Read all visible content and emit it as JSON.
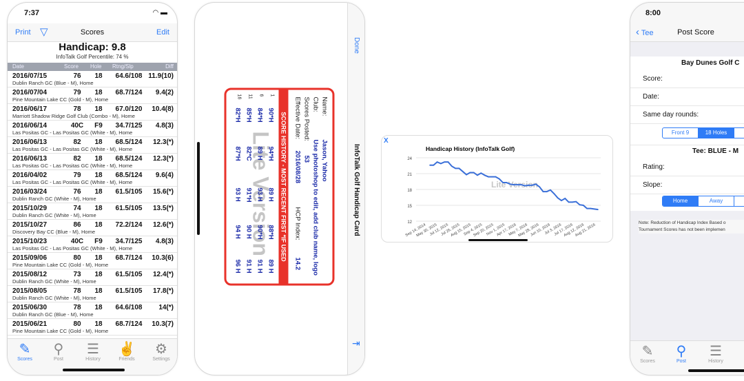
{
  "scores_screen": {
    "time": "7:37",
    "nav": {
      "print": "Print",
      "title": "Scores",
      "edit": "Edit"
    },
    "handicap": "Handicap: 9.8",
    "percentile": "InfoTalk Golf Percentile: 74 %",
    "columns": [
      "Date",
      "Score",
      "Hole",
      "Rtng/Slp",
      "Diff"
    ],
    "rows": [
      {
        "date": "2016/07/15",
        "score": "76",
        "hole": "18",
        "rating": "64.6/108",
        "diff": "11.9(10)",
        "course": "Dublin Ranch GC (Blue - M), Home"
      },
      {
        "date": "2016/07/04",
        "score": "79",
        "hole": "18",
        "rating": "68.7/124",
        "diff": "9.4(2)",
        "course": "Pine Mountain Lake CC (Gold - M), Home"
      },
      {
        "date": "2016/06/17",
        "score": "78",
        "hole": "18",
        "rating": "67.0/120",
        "diff": "10.4(8)",
        "course": "Marriott Shadow Ridge Golf Club (Combo - M), Home"
      },
      {
        "date": "2016/06/14",
        "score": "40C",
        "hole": "F9",
        "rating": "34.7/125",
        "diff": "4.8(3)",
        "course": "Las Positas GC - Las Positas GC (White - M), Home"
      },
      {
        "date": "2016/06/13",
        "score": "82",
        "hole": "18",
        "rating": "68.5/124",
        "diff": "12.3(*)",
        "course": "Las Positas GC - Las Positas GC (White - M), Home"
      },
      {
        "date": "2016/06/13",
        "score": "82",
        "hole": "18",
        "rating": "68.5/124",
        "diff": "12.3(*)",
        "course": "Las Positas GC - Las Positas GC (White - M), Home"
      },
      {
        "date": "2016/04/02",
        "score": "79",
        "hole": "18",
        "rating": "68.5/124",
        "diff": "9.6(4)",
        "course": "Las Positas GC - Las Positas GC (White - M), Home"
      },
      {
        "date": "2016/03/24",
        "score": "76",
        "hole": "18",
        "rating": "61.5/105",
        "diff": "15.6(*)",
        "course": "Dublin Ranch GC (White - M), Home"
      },
      {
        "date": "2015/10/29",
        "score": "74",
        "hole": "18",
        "rating": "61.5/105",
        "diff": "13.5(*)",
        "course": "Dublin Ranch GC (White - M), Home"
      },
      {
        "date": "2015/10/27",
        "score": "86",
        "hole": "18",
        "rating": "72.2/124",
        "diff": "12.6(*)",
        "course": "Discovery Bay CC (Blue - M), Home"
      },
      {
        "date": "2015/10/23",
        "score": "40C",
        "hole": "F9",
        "rating": "34.7/125",
        "diff": "4.8(3)",
        "course": "Las Positas GC - Las Positas GC (White - M), Home"
      },
      {
        "date": "2015/09/06",
        "score": "80",
        "hole": "18",
        "rating": "68.7/124",
        "diff": "10.3(6)",
        "course": "Pine Mountain Lake CC (Gold - M), Home"
      },
      {
        "date": "2015/08/12",
        "score": "73",
        "hole": "18",
        "rating": "61.5/105",
        "diff": "12.4(*)",
        "course": "Dublin Ranch GC (White - M), Home"
      },
      {
        "date": "2015/08/05",
        "score": "78",
        "hole": "18",
        "rating": "61.5/105",
        "diff": "17.8(*)",
        "course": "Dublin Ranch GC (White - M), Home"
      },
      {
        "date": "2015/06/30",
        "score": "78",
        "hole": "18",
        "rating": "64.6/108",
        "diff": "14(*)",
        "course": "Dublin Ranch GC (Blue - M), Home"
      },
      {
        "date": "2015/06/21",
        "score": "80",
        "hole": "18",
        "rating": "68.7/124",
        "diff": "10.3(7)",
        "course": "Pine Mountain Lake CC (Gold - M), Home"
      }
    ],
    "tabs": [
      "Scores",
      "Post",
      "History",
      "Friends",
      "Settings"
    ],
    "active_tab": "Scores"
  },
  "card_screen": {
    "done": "Done",
    "title": "InfoTalk Golf Handicap Card",
    "name_label": "Name:",
    "name": "Jason, Yahoo",
    "club_label": "Club:",
    "club": "Use photoshop to edit, add club name, logo",
    "posted_label": "Scores Posted:",
    "posted": "53",
    "date_label": "Effective Date:",
    "date": "2016/08/28",
    "hcp_label": "HCP Index:",
    "hcp": "14.2",
    "history_banner": "SCORE HISTORY - MOST RECENT FIRST   *IF USED",
    "history": [
      {
        "n": "1",
        "scores": [
          "90*H",
          "94*H",
          "89 H",
          "88*H",
          "89 H"
        ]
      },
      {
        "n": "6",
        "scores": [
          "84*H",
          "89 H",
          "93 H",
          "90*H",
          "91 H"
        ]
      },
      {
        "n": "11",
        "scores": [
          "85*H",
          "82*C",
          "91*H",
          "90 H",
          "91 H"
        ]
      },
      {
        "n": "16",
        "scores": [
          "82*H",
          "87*H",
          "93 H",
          "94 H",
          "96 H"
        ]
      }
    ],
    "watermark": "Lite Version"
  },
  "chart_screen": {
    "close": "X",
    "watermark": "Lite Version",
    "chart_data": {
      "type": "line",
      "title": "Handicap History (InfoTalk Golf)",
      "ylim": [
        12,
        24
      ],
      "yticks": [
        12,
        15,
        18,
        21,
        24
      ],
      "grid": true,
      "color": "#3a6fd8",
      "x_labels": [
        "Sep 14, 2014",
        "May 30, 2015",
        "Jul 12, 2015",
        "Jul 26, 2015",
        "Aug 15, 2015",
        "Sep 4, 2015",
        "Sep 20, 2015",
        "Nov 1, 2015",
        "Apr 17, 2016",
        "May 7, 2016",
        "May 28, 2016",
        "Jun 10, 2016",
        "Jul 3, 2016",
        "Jul 17, 2016",
        "Aug 12, 2016",
        "Aug 21, 2016"
      ],
      "values": [
        22.6,
        22.6,
        23.2,
        22.9,
        23.2,
        23.2,
        22.4,
        22.0,
        22.0,
        21.4,
        20.8,
        21.2,
        21.2,
        20.7,
        21.1,
        20.7,
        20.4,
        20.4,
        20.4,
        20.0,
        19.3,
        19.3,
        19.0,
        18.9,
        18.9,
        18.9,
        18.7,
        18.8,
        18.8,
        19.0,
        18.5,
        17.6,
        17.6,
        17.9,
        17.2,
        16.4,
        15.9,
        16.3,
        15.6,
        15.6,
        15.7,
        15.1,
        15.0,
        14.4,
        14.4,
        14.3,
        14.2
      ]
    }
  },
  "post_screen": {
    "time": "8:00",
    "back": "Tee",
    "title": "Post Score",
    "course": "Bay Dunes Golf C",
    "score_label": "Score:",
    "date_label": "Date:",
    "same_day_label": "Same day rounds:",
    "holes": [
      "Front 9",
      "18 Holes"
    ],
    "holes_selected": "18 Holes",
    "tee": "Tee: BLUE - M",
    "rating_label": "Rating:",
    "slope_label": "Slope:",
    "venue": [
      "Home",
      "Away",
      "T"
    ],
    "venue_selected": "Home",
    "note": "Note: Reduction of Handicap Index Based o Tournament Scores has not been implemen",
    "tabs": [
      "Scores",
      "Post",
      "History"
    ],
    "active_tab": "Post"
  }
}
